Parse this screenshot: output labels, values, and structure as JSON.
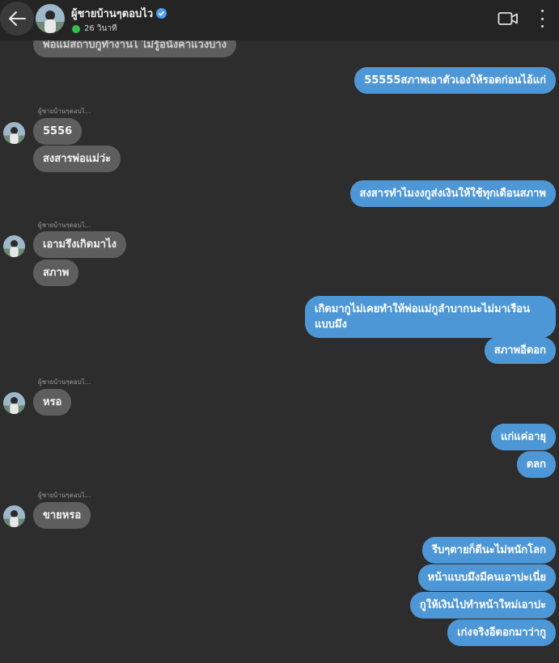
{
  "header": {
    "name": "ผู้ชายบ้านๆตอบไว",
    "status": "26 วินาที"
  },
  "top_partial_message": "พ่อแม่สถาบกูทำงานไ ไม่รู้อนังคาแวงบาง",
  "messages": [
    {
      "id": "m1",
      "dir": "out",
      "text": "55555สภาพเอาตัวเองให้รอดก่อนไอ้แก่"
    },
    {
      "id": "m2",
      "dir": "in",
      "sender": "ผู้ชายบ้านๆตอบไ...",
      "text": "5556"
    },
    {
      "id": "m3",
      "dir": "in",
      "text": "สงสารพ่อแม่ว่ะ"
    },
    {
      "id": "m4",
      "dir": "out",
      "text": "สงสารทำไมงงกูส่งเงินให้ใช้ทุกเดือนสภาพ"
    },
    {
      "id": "m5",
      "dir": "in",
      "sender": "ผู้ชายบ้านๆตอบไ...",
      "text": "เอามรึงเกิดมาไง"
    },
    {
      "id": "m6",
      "dir": "in",
      "text": "สภาพ"
    },
    {
      "id": "m7",
      "dir": "out",
      "text": "เกิดมากูไม่เคยทำให้พ่อแม่กูลำบากนะไม่มาเรือนแบบมึง"
    },
    {
      "id": "m8",
      "dir": "out",
      "text": "สภาพอีดอก"
    },
    {
      "id": "m9",
      "dir": "in",
      "sender": "ผู้ชายบ้านๆตอบไ...",
      "text": "หรอ"
    },
    {
      "id": "m10",
      "dir": "out",
      "text": "แก่แค่อายุ"
    },
    {
      "id": "m11",
      "dir": "out",
      "text": "ตลก"
    },
    {
      "id": "m12",
      "dir": "in",
      "sender": "ผู้ชายบ้านๆตอบไ...",
      "text": "ขายหรอ"
    },
    {
      "id": "m13",
      "dir": "out",
      "text": "รีบๆตายก็ดีนะไม่หนักโลก"
    },
    {
      "id": "m14",
      "dir": "out",
      "text": "หน้าแบบมึงมีคนเอาปะเนี่ย"
    },
    {
      "id": "m15",
      "dir": "out",
      "text": "กูให้เงินไปทำหน้าใหม่เอาปะ"
    },
    {
      "id": "m16",
      "dir": "out",
      "text": "เก่งจริงอีดอกมาว่ากู"
    }
  ],
  "colors": {
    "background": "#2d2d2d",
    "header": "#242424",
    "incoming_bubble": "#5e5e5e",
    "outgoing_bubble": "#4e97d6",
    "online": "#31c24d",
    "verified": "#4f9cf0"
  },
  "icons": [
    "back-arrow-icon",
    "verified-icon",
    "video-call-icon",
    "more-options-icon"
  ]
}
